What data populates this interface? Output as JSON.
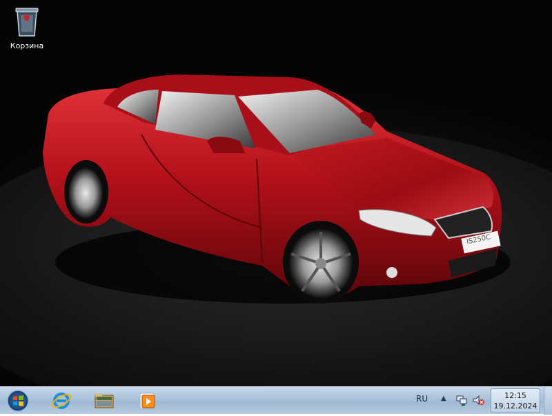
{
  "desktop": {
    "icons": [
      {
        "label": "Корзина",
        "icon": "recycle-bin-icon"
      }
    ],
    "wallpaper": "red-convertible-car",
    "car_plate": "IS250C"
  },
  "taskbar": {
    "start": {
      "icon": "windows-start-icon"
    },
    "pinned": [
      {
        "name": "internet-explorer",
        "icon": "internet-explorer-icon"
      },
      {
        "name": "windows-explorer",
        "icon": "folder-icon"
      },
      {
        "name": "media-player",
        "icon": "media-player-icon"
      }
    ],
    "tray": {
      "language": "RU",
      "overflow_icon": "chevron-up-icon",
      "icons": [
        "network-icon",
        "volume-muted-icon"
      ],
      "clock_time": "12:15",
      "clock_date": "19.12.2024"
    }
  },
  "colors": {
    "car_body": "#b3101a",
    "taskbar": "#a9c1da",
    "desktop_bg": "#0a0a0a"
  }
}
